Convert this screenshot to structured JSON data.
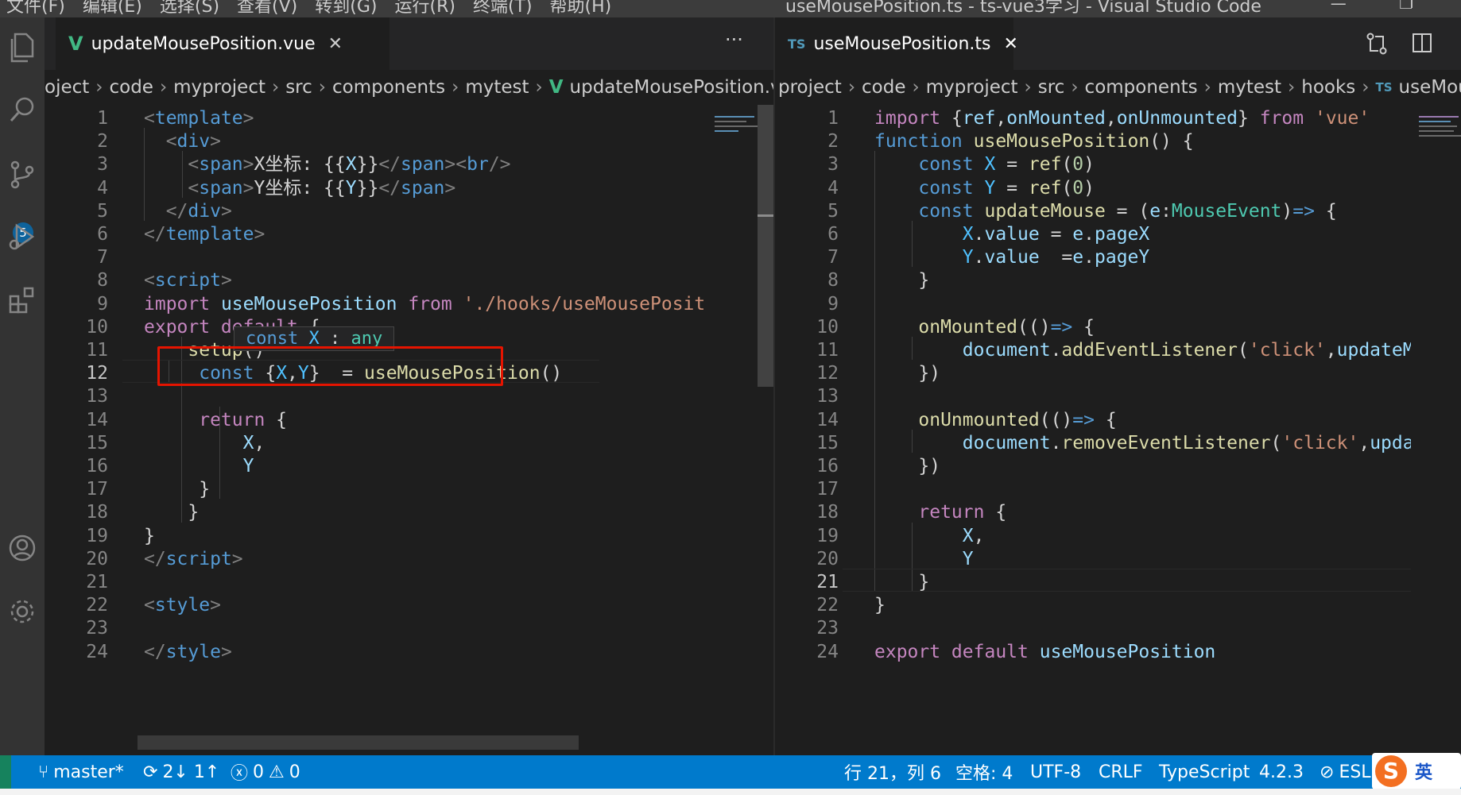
{
  "menu": [
    "文件(F)",
    "编辑(E)",
    "选择(S)",
    "查看(V)",
    "转到(G)",
    "运行(R)",
    "终端(T)",
    "帮助(H)"
  ],
  "window_title": "useMousePosition.ts - ts-vue3学习 - Visual Studio Code",
  "activity": {
    "scm_badge": "5"
  },
  "left": {
    "tab": "updateMousePosition.vue",
    "more_label": "···",
    "breadcrumbs": [
      "oject",
      "code",
      "myproject",
      "src",
      "components",
      "mytest",
      "updateMousePosition.vue"
    ],
    "hover": {
      "kw": "const",
      "name": "X",
      "colon": ":",
      "type": "any"
    },
    "lines": [
      [
        [
          "pun",
          "<"
        ],
        [
          "tag",
          "template"
        ],
        [
          "pun",
          ">"
        ]
      ],
      [
        [
          "pun",
          "  <"
        ],
        [
          "tag",
          "div"
        ],
        [
          "pun",
          ">"
        ]
      ],
      [
        [
          "pun",
          "    <"
        ],
        [
          "tag",
          "span"
        ],
        [
          "pun",
          ">"
        ],
        [
          "plain",
          "X坐标: {{"
        ],
        [
          "var",
          "X"
        ],
        [
          "plain",
          "}}"
        ],
        [
          "pun",
          "</"
        ],
        [
          "tag",
          "span"
        ],
        [
          "pun",
          "><"
        ],
        [
          "tag",
          "br"
        ],
        [
          "pun",
          "/>"
        ]
      ],
      [
        [
          "pun",
          "    <"
        ],
        [
          "tag",
          "span"
        ],
        [
          "pun",
          ">"
        ],
        [
          "plain",
          "Y坐标: {{"
        ],
        [
          "var",
          "Y"
        ],
        [
          "plain",
          "}}"
        ],
        [
          "pun",
          "</"
        ],
        [
          "tag",
          "span"
        ],
        [
          "pun",
          ">"
        ]
      ],
      [
        [
          "pun",
          "  </"
        ],
        [
          "tag",
          "div"
        ],
        [
          "pun",
          ">"
        ]
      ],
      [
        [
          "pun",
          "</"
        ],
        [
          "tag",
          "template"
        ],
        [
          "pun",
          ">"
        ]
      ],
      [],
      [
        [
          "pun",
          "<"
        ],
        [
          "tag",
          "script"
        ],
        [
          "pun",
          ">"
        ]
      ],
      [
        [
          "ctl",
          "import "
        ],
        [
          "var",
          "useMousePosition "
        ],
        [
          "ctl",
          "from "
        ],
        [
          "str",
          "'./hooks/useMousePosit"
        ]
      ],
      [
        [
          "ctl",
          "export default "
        ],
        [
          "plain",
          "{"
        ]
      ],
      [
        [
          "fn",
          "    setup"
        ],
        [
          "plain",
          "()"
        ]
      ],
      [
        [
          "kw",
          "     const "
        ],
        [
          "plain",
          "{"
        ],
        [
          "cst",
          "X"
        ],
        [
          "plain",
          ","
        ],
        [
          "cst",
          "Y"
        ],
        [
          "plain",
          "}  = "
        ],
        [
          "fn",
          "useMousePosition"
        ],
        [
          "plain",
          "()"
        ]
      ],
      [],
      [
        [
          "ctl",
          "     return "
        ],
        [
          "plain",
          "{"
        ]
      ],
      [
        [
          "var",
          "         X"
        ],
        [
          "plain",
          ","
        ]
      ],
      [
        [
          "var",
          "         Y"
        ]
      ],
      [
        [
          "plain",
          "     }"
        ]
      ],
      [
        [
          "plain",
          "    }"
        ]
      ],
      [
        [
          "plain",
          "}"
        ]
      ],
      [
        [
          "pun",
          "</"
        ],
        [
          "tag",
          "script"
        ],
        [
          "pun",
          ">"
        ]
      ],
      [],
      [
        [
          "pun",
          "<"
        ],
        [
          "tag",
          "style"
        ],
        [
          "pun",
          ">"
        ]
      ],
      [],
      [
        [
          "pun",
          "</"
        ],
        [
          "tag",
          "style"
        ],
        [
          "pun",
          ">"
        ]
      ]
    ]
  },
  "right": {
    "tab": "useMousePosition.ts",
    "tab_badge": "TS",
    "breadcrumbs": [
      "project",
      "code",
      "myproject",
      "src",
      "components",
      "mytest",
      "hooks",
      "useMou"
    ],
    "current_line": 21,
    "lines": [
      [
        [
          "ctl",
          "import "
        ],
        [
          "plain",
          "{"
        ],
        [
          "var",
          "ref"
        ],
        [
          "plain",
          ","
        ],
        [
          "var",
          "onMounted"
        ],
        [
          "plain",
          ","
        ],
        [
          "var",
          "onUnmounted"
        ],
        [
          "plain",
          "} "
        ],
        [
          "ctl",
          "from "
        ],
        [
          "str",
          "'vue'"
        ]
      ],
      [
        [
          "kw",
          "function "
        ],
        [
          "fn",
          "useMousePosition"
        ],
        [
          "plain",
          "() {"
        ]
      ],
      [
        [
          "kw",
          "    const "
        ],
        [
          "cst",
          "X"
        ],
        [
          "plain",
          " = "
        ],
        [
          "fn",
          "ref"
        ],
        [
          "plain",
          "("
        ],
        [
          "num",
          "0"
        ],
        [
          "plain",
          ")"
        ]
      ],
      [
        [
          "kw",
          "    const "
        ],
        [
          "cst",
          "Y"
        ],
        [
          "plain",
          " = "
        ],
        [
          "fn",
          "ref"
        ],
        [
          "plain",
          "("
        ],
        [
          "num",
          "0"
        ],
        [
          "plain",
          ")"
        ]
      ],
      [
        [
          "kw",
          "    const "
        ],
        [
          "fn",
          "updateMouse"
        ],
        [
          "plain",
          " = ("
        ],
        [
          "var",
          "e"
        ],
        [
          "plain",
          ":"
        ],
        [
          "ty",
          "MouseEvent"
        ],
        [
          "plain",
          ")"
        ],
        [
          "kw",
          "=>"
        ],
        [
          "plain",
          " {"
        ]
      ],
      [
        [
          "cst",
          "        X"
        ],
        [
          "plain",
          "."
        ],
        [
          "var",
          "value"
        ],
        [
          "plain",
          " = "
        ],
        [
          "var",
          "e"
        ],
        [
          "plain",
          "."
        ],
        [
          "var",
          "pageX"
        ]
      ],
      [
        [
          "cst",
          "        Y"
        ],
        [
          "plain",
          "."
        ],
        [
          "var",
          "value"
        ],
        [
          "plain",
          "  ="
        ],
        [
          "var",
          "e"
        ],
        [
          "plain",
          "."
        ],
        [
          "var",
          "pageY"
        ]
      ],
      [
        [
          "plain",
          "    }"
        ]
      ],
      [],
      [
        [
          "fn",
          "    onMounted"
        ],
        [
          "plain",
          "(()"
        ],
        [
          "kw",
          "=>"
        ],
        [
          "plain",
          " {"
        ]
      ],
      [
        [
          "var",
          "        document"
        ],
        [
          "plain",
          "."
        ],
        [
          "fn",
          "addEventListener"
        ],
        [
          "plain",
          "("
        ],
        [
          "str",
          "'click'"
        ],
        [
          "plain",
          ","
        ],
        [
          "var",
          "updateMou"
        ]
      ],
      [
        [
          "plain",
          "    })"
        ]
      ],
      [],
      [
        [
          "fn",
          "    onUnmounted"
        ],
        [
          "plain",
          "(()"
        ],
        [
          "kw",
          "=>"
        ],
        [
          "plain",
          " {"
        ]
      ],
      [
        [
          "var",
          "        document"
        ],
        [
          "plain",
          "."
        ],
        [
          "fn",
          "removeEventListener"
        ],
        [
          "plain",
          "("
        ],
        [
          "str",
          "'click'"
        ],
        [
          "plain",
          ","
        ],
        [
          "var",
          "update"
        ]
      ],
      [
        [
          "plain",
          "    })"
        ]
      ],
      [],
      [
        [
          "ctl",
          "    return "
        ],
        [
          "plain",
          "{"
        ]
      ],
      [
        [
          "var",
          "        X"
        ],
        [
          "plain",
          ","
        ]
      ],
      [
        [
          "var",
          "        Y"
        ]
      ],
      [
        [
          "plain",
          "    }"
        ]
      ],
      [
        [
          "plain",
          "}"
        ]
      ],
      [],
      [
        [
          "ctl",
          "export default "
        ],
        [
          "var",
          "useMousePosition"
        ]
      ]
    ]
  },
  "status": {
    "branch": "master*",
    "sync": "2↓ 1↑",
    "errors": "0",
    "warnings": "0",
    "position": "行 21，列 6",
    "indent": "空格: 4",
    "encoding": "UTF-8",
    "eol": "CRLF",
    "language": "TypeScript",
    "version": "4.2.3",
    "eslint": "ESLI",
    "ime": "英"
  },
  "colors": {
    "statusbar": "#007acc",
    "activitybar": "#333333",
    "editor": "#1e1e1e",
    "highlight_box": "#e51400"
  }
}
